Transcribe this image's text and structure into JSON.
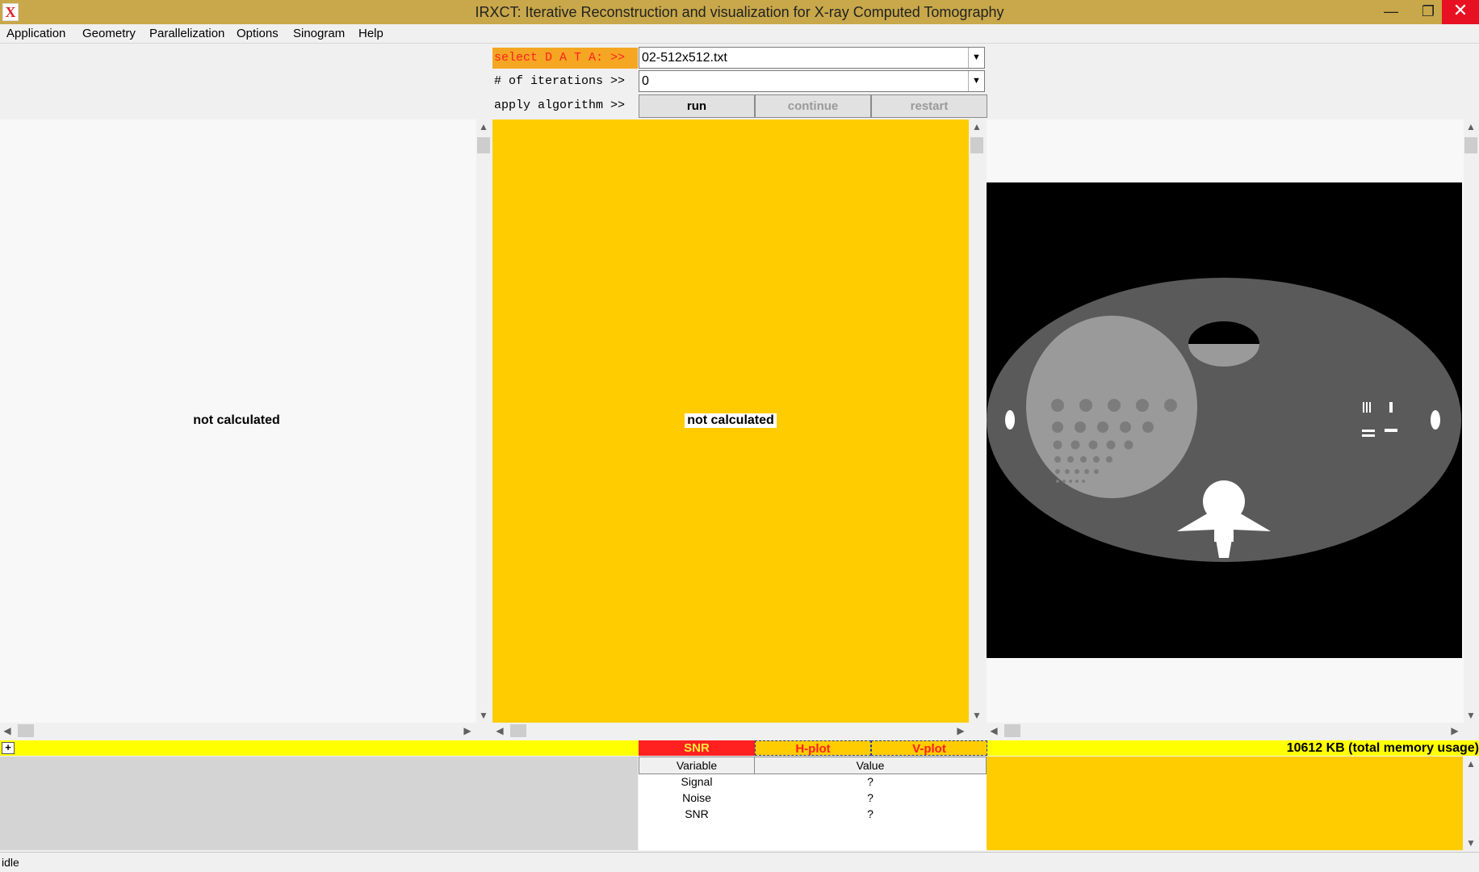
{
  "window": {
    "title": "IRXCT: Iterative Reconstruction and visualization for X-ray Computed Tomography",
    "icon_letter": "X",
    "controls": {
      "minimize": "—",
      "maximize": "❐",
      "close": "✕"
    }
  },
  "menu": [
    "Application",
    "Geometry",
    "Parallelization",
    "Options",
    "Sinogram",
    "Help"
  ],
  "controls": {
    "select_label": "select D A T A: >>",
    "select_value": "02-512x512.txt",
    "iterations_label": "# of iterations >>",
    "iterations_value": "0",
    "apply_label": "apply algorithm >>",
    "run_label": "run",
    "continue_label": "continue",
    "restart_label": "restart"
  },
  "panels": {
    "left_text": "not calculated",
    "middle_text": "not calculated"
  },
  "bottom": {
    "plus_label": "+",
    "tabs": [
      "SNR",
      "H-plot",
      "V-plot"
    ],
    "memory": "10612 KB (total memory usage)",
    "table": {
      "headers": [
        "Variable",
        "Value"
      ],
      "rows": [
        {
          "variable": "Signal",
          "value": "?"
        },
        {
          "variable": "Noise",
          "value": "?"
        },
        {
          "variable": "SNR",
          "value": "?"
        }
      ]
    }
  },
  "status": "idle",
  "colors": {
    "title_bar": "#c8a84a",
    "panel_yellow": "#ffcc00",
    "toolbar_yellow": "#ffff00",
    "accent_red": "#ff2020"
  }
}
